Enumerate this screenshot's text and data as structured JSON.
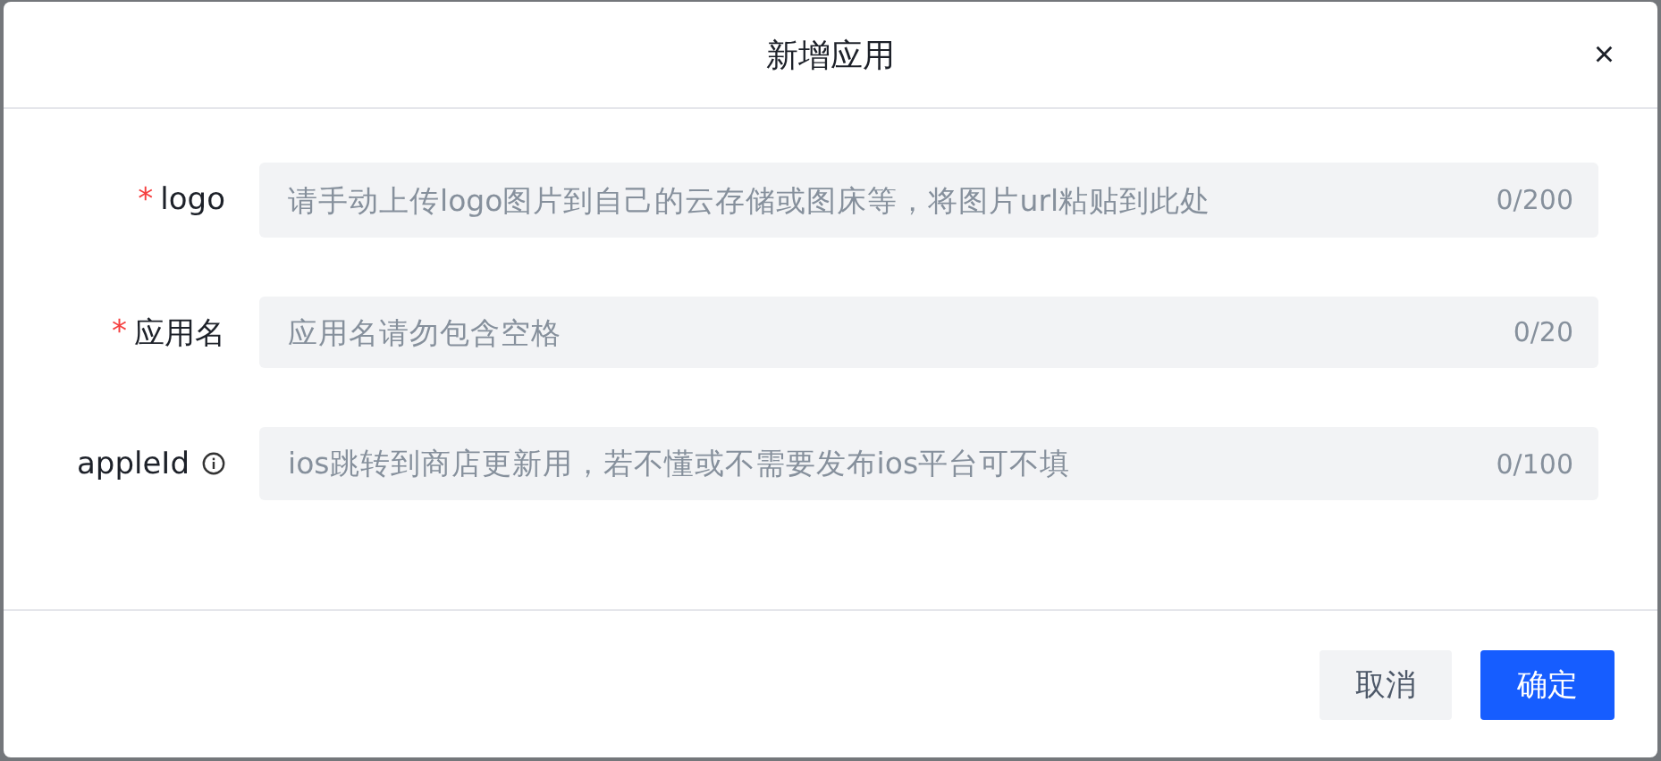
{
  "dialog": {
    "title": "新增应用",
    "close": "×"
  },
  "fields": [
    {
      "mark": "*",
      "label": "logo",
      "info": false,
      "placeholder": "请手动上传logo图片到自己的云存储或图床等，将图片url粘贴到此处",
      "counter": "0/200"
    },
    {
      "mark": "*",
      "label": "应用名",
      "info": false,
      "placeholder": "应用名请勿包含空格",
      "counter": "0/20"
    },
    {
      "label": "appleId",
      "info": true,
      "placeholder": "ios跳转到商店更新用，若不懂或不需要发布ios平台可不填",
      "counter": "0/100"
    }
  ],
  "buttons": [
    {
      "label": "取消",
      "kind": "secondary"
    },
    {
      "label": "确定",
      "kind": "primary"
    }
  ]
}
